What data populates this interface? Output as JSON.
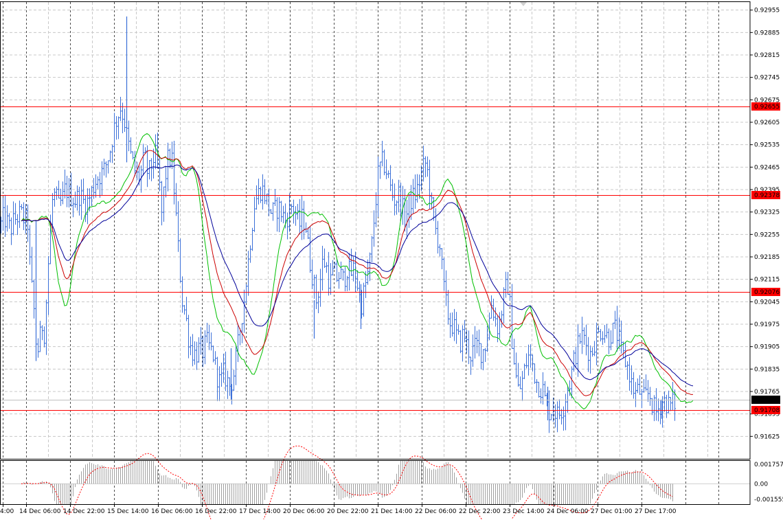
{
  "chart_data": {
    "type": "line",
    "main": {
      "ylim": [
        0.91555,
        0.9298
      ],
      "price_ticks": [
        "0.92955",
        "0.92885",
        "0.92815",
        "0.92745",
        "0.92675",
        "0.92605",
        "0.92535",
        "0.92465",
        "0.92395",
        "0.92325",
        "0.92255",
        "0.92185",
        "0.92115",
        "0.92045",
        "0.91975",
        "0.91905",
        "0.91835",
        "0.91765",
        "0.91695",
        "0.91625"
      ],
      "time_labels": [
        "4:00",
        "14 Dec 06:00",
        "14 Dec 22:00",
        "15 Dec 14:00",
        "16 Dec 06:00",
        "16 Dec 22:00",
        "17 Dec 14:00",
        "20 Dec 06:00",
        "20 Dec 22:00",
        "21 Dec 14:00",
        "22 Dec 06:00",
        "22 Dec 22:00",
        "23 Dec 14:00",
        "24 Dec 06:00",
        "27 Dec 01:00",
        "27 Dec 17:00"
      ],
      "levels": [
        {
          "value": 0.92655,
          "label": "0.92655",
          "color": "#ff0000"
        },
        {
          "value": 0.92378,
          "label": "0.92378",
          "color": "#ff0000"
        },
        {
          "value": 0.92076,
          "label": "0.92076",
          "color": "#ff0000"
        },
        {
          "value": 0.91708,
          "label": "0.91708",
          "color": "#ff0000"
        }
      ],
      "current_price": {
        "value": 0.91739,
        "label": "0.91739"
      },
      "price_anchors": [
        [
          0,
          0.9228
        ],
        [
          5,
          0.9231
        ],
        [
          10,
          0.9229
        ],
        [
          15,
          0.9227
        ],
        [
          20,
          0.923
        ],
        [
          25,
          0.9231
        ],
        [
          30,
          0.9232
        ],
        [
          35,
          0.923
        ],
        [
          40,
          0.9229
        ],
        [
          44,
          0.9212
        ],
        [
          48,
          0.9205
        ],
        [
          52,
          0.9192
        ],
        [
          56,
          0.9189
        ],
        [
          60,
          0.9198
        ],
        [
          64,
          0.9195
        ],
        [
          68,
          0.9208
        ],
        [
          72,
          0.9225
        ],
        [
          76,
          0.9236
        ],
        [
          80,
          0.9238
        ],
        [
          85,
          0.9234
        ],
        [
          90,
          0.9236
        ],
        [
          95,
          0.924
        ],
        [
          100,
          0.9238
        ],
        [
          105,
          0.9237
        ],
        [
          110,
          0.9236
        ],
        [
          115,
          0.9238
        ],
        [
          120,
          0.9236
        ],
        [
          125,
          0.9235
        ],
        [
          130,
          0.9237
        ],
        [
          135,
          0.924
        ],
        [
          140,
          0.9243
        ],
        [
          145,
          0.9244
        ],
        [
          150,
          0.9245
        ],
        [
          155,
          0.9248
        ],
        [
          160,
          0.9252
        ],
        [
          165,
          0.9258
        ],
        [
          170,
          0.9262
        ],
        [
          175,
          0.9265
        ],
        [
          180,
          0.9262
        ],
        [
          185,
          0.9255
        ],
        [
          190,
          0.925
        ],
        [
          195,
          0.9246
        ],
        [
          200,
          0.9243
        ],
        [
          205,
          0.9245
        ],
        [
          210,
          0.925
        ],
        [
          215,
          0.9244
        ],
        [
          220,
          0.9247
        ],
        [
          225,
          0.9251
        ],
        [
          230,
          0.9245
        ],
        [
          235,
          0.9232
        ],
        [
          240,
          0.9243
        ],
        [
          245,
          0.925
        ],
        [
          250,
          0.9248
        ],
        [
          255,
          0.9234
        ],
        [
          260,
          0.9218
        ],
        [
          265,
          0.9205
        ],
        [
          270,
          0.92
        ],
        [
          275,
          0.9192
        ],
        [
          280,
          0.9189
        ],
        [
          285,
          0.9188
        ],
        [
          290,
          0.919
        ],
        [
          295,
          0.9189
        ],
        [
          300,
          0.9192
        ],
        [
          305,
          0.919
        ],
        [
          310,
          0.9188
        ],
        [
          315,
          0.9182
        ],
        [
          320,
          0.9179
        ],
        [
          325,
          0.9182
        ],
        [
          330,
          0.918
        ],
        [
          335,
          0.9178
        ],
        [
          340,
          0.9182
        ],
        [
          345,
          0.9189
        ],
        [
          350,
          0.9198
        ],
        [
          355,
          0.9205
        ],
        [
          360,
          0.9215
        ],
        [
          365,
          0.9226
        ],
        [
          370,
          0.9235
        ],
        [
          375,
          0.9238
        ],
        [
          380,
          0.924
        ],
        [
          385,
          0.9238
        ],
        [
          390,
          0.9235
        ],
        [
          395,
          0.9232
        ],
        [
          400,
          0.9233
        ],
        [
          405,
          0.9234
        ],
        [
          410,
          0.9232
        ],
        [
          415,
          0.923
        ],
        [
          420,
          0.9232
        ],
        [
          425,
          0.9235
        ],
        [
          430,
          0.9232
        ],
        [
          435,
          0.9228
        ],
        [
          440,
          0.9231
        ],
        [
          445,
          0.9228
        ],
        [
          450,
          0.9218
        ],
        [
          455,
          0.9212
        ],
        [
          460,
          0.9205
        ],
        [
          465,
          0.921
        ],
        [
          470,
          0.9218
        ],
        [
          475,
          0.9215
        ],
        [
          480,
          0.921
        ],
        [
          485,
          0.9214
        ],
        [
          490,
          0.9212
        ],
        [
          495,
          0.9213
        ],
        [
          500,
          0.9211
        ],
        [
          505,
          0.9215
        ],
        [
          510,
          0.9213
        ],
        [
          515,
          0.9215
        ],
        [
          520,
          0.921
        ],
        [
          525,
          0.9203
        ],
        [
          530,
          0.9208
        ],
        [
          535,
          0.9213
        ],
        [
          540,
          0.922
        ],
        [
          545,
          0.9232
        ],
        [
          550,
          0.9244
        ],
        [
          555,
          0.9248
        ],
        [
          560,
          0.9247
        ],
        [
          565,
          0.9243
        ],
        [
          570,
          0.9238
        ],
        [
          575,
          0.9236
        ],
        [
          580,
          0.9238
        ],
        [
          585,
          0.9234
        ],
        [
          590,
          0.923
        ],
        [
          595,
          0.9235
        ],
        [
          600,
          0.9237
        ],
        [
          605,
          0.9238
        ],
        [
          610,
          0.9242
        ],
        [
          615,
          0.9246
        ],
        [
          620,
          0.9248
        ],
        [
          625,
          0.924
        ],
        [
          630,
          0.923
        ],
        [
          635,
          0.9226
        ],
        [
          640,
          0.9222
        ],
        [
          645,
          0.921
        ],
        [
          650,
          0.9202
        ],
        [
          655,
          0.9198
        ],
        [
          660,
          0.9197
        ],
        [
          665,
          0.9193
        ],
        [
          670,
          0.9192
        ],
        [
          675,
          0.9195
        ],
        [
          680,
          0.919
        ],
        [
          685,
          0.9188
        ],
        [
          690,
          0.919
        ],
        [
          695,
          0.9191
        ],
        [
          700,
          0.9189
        ],
        [
          705,
          0.919
        ],
        [
          710,
          0.9196
        ],
        [
          715,
          0.9204
        ],
        [
          720,
          0.92
        ],
        [
          725,
          0.9196
        ],
        [
          730,
          0.9202
        ],
        [
          735,
          0.9208
        ],
        [
          740,
          0.921
        ],
        [
          745,
          0.9193
        ],
        [
          750,
          0.9182
        ],
        [
          755,
          0.9176
        ],
        [
          760,
          0.918
        ],
        [
          765,
          0.9185
        ],
        [
          770,
          0.9188
        ],
        [
          775,
          0.9185
        ],
        [
          780,
          0.918
        ],
        [
          785,
          0.9178
        ],
        [
          790,
          0.9177
        ],
        [
          795,
          0.9172
        ],
        [
          800,
          0.917
        ],
        [
          805,
          0.9172
        ],
        [
          810,
          0.9169
        ],
        [
          815,
          0.917
        ],
        [
          820,
          0.9172
        ],
        [
          825,
          0.9177
        ],
        [
          830,
          0.918
        ],
        [
          835,
          0.9186
        ],
        [
          840,
          0.919
        ],
        [
          845,
          0.9194
        ],
        [
          850,
          0.9193
        ],
        [
          855,
          0.919
        ],
        [
          860,
          0.9188
        ],
        [
          865,
          0.9192
        ],
        [
          870,
          0.9194
        ],
        [
          875,
          0.9196
        ],
        [
          880,
          0.9195
        ],
        [
          885,
          0.9193
        ],
        [
          890,
          0.9195
        ],
        [
          895,
          0.9196
        ],
        [
          900,
          0.9193
        ],
        [
          905,
          0.9188
        ],
        [
          910,
          0.9186
        ],
        [
          915,
          0.9183
        ],
        [
          920,
          0.9178
        ],
        [
          925,
          0.9176
        ],
        [
          930,
          0.9177
        ],
        [
          935,
          0.9174
        ],
        [
          940,
          0.9175
        ],
        [
          945,
          0.9176
        ],
        [
          950,
          0.9172
        ],
        [
          955,
          0.917
        ],
        [
          960,
          0.9172
        ],
        [
          965,
          0.9174
        ],
        [
          970,
          0.9173
        ],
        [
          975,
          0.9172
        ],
        [
          980,
          0.9173
        ]
      ],
      "spikes": [
        {
          "x": 184,
          "high": 0.92935,
          "low": 0.9248
        },
        {
          "x": 52,
          "high": 0.923,
          "low": 0.9186
        },
        {
          "x": 336,
          "high": 0.919,
          "low": 0.9174
        },
        {
          "x": 457,
          "high": 0.9205,
          "low": 0.9193
        },
        {
          "x": 525,
          "high": 0.921,
          "low": 0.9196
        },
        {
          "x": 797,
          "high": 0.9178,
          "low": 0.91675
        },
        {
          "x": 963,
          "high": 0.9174,
          "low": 0.9168
        }
      ]
    },
    "moving_averages": [
      {
        "period": 10,
        "color": "#00c000"
      },
      {
        "period": 20,
        "color": "#cc0000"
      },
      {
        "period": 34,
        "color": "#000099"
      }
    ],
    "oscillator": {
      "ticks": [
        "0.001757",
        "0.00",
        "-0.001555"
      ],
      "ylim": [
        -0.001555,
        0.001757
      ],
      "zero_color": "#b0b0b0",
      "signal_color": "#ff0000"
    },
    "grid": true,
    "colors": {
      "background": "#ffffff",
      "bars": "#3a6fd8",
      "grid": "#c8c8c8",
      "level_label_bg": "#ff0000",
      "price_label_bg": "#000000"
    }
  }
}
